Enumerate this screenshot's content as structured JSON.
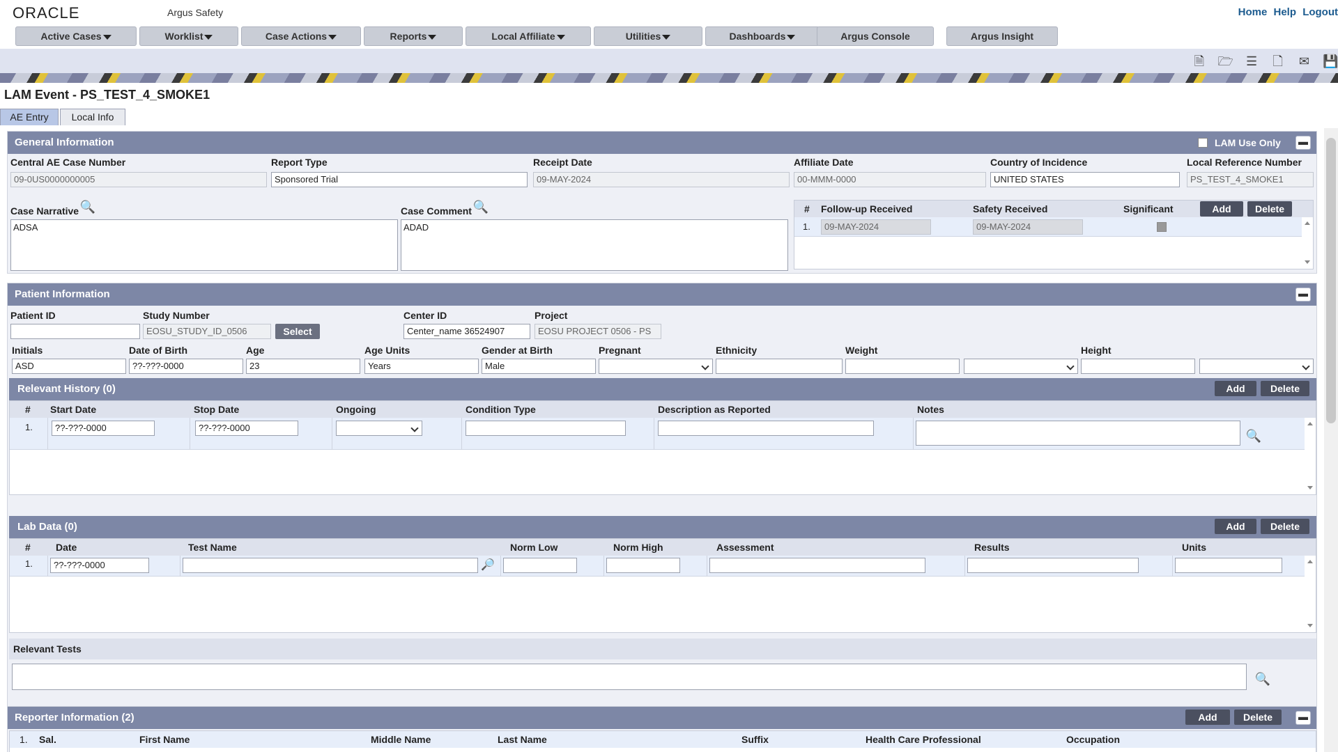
{
  "app": {
    "logo": "ORACLE",
    "product": "Argus Safety"
  },
  "toplinks": {
    "home": "Home",
    "help": "Help",
    "logout": "Logout"
  },
  "menus": [
    {
      "label": "Active Cases",
      "dropdown": true
    },
    {
      "label": "Worklist",
      "dropdown": true
    },
    {
      "label": "Case Actions",
      "dropdown": true
    },
    {
      "label": "Reports",
      "dropdown": true
    },
    {
      "label": "Local Affiliate",
      "dropdown": true
    },
    {
      "label": "Utilities",
      "dropdown": true
    },
    {
      "label": "Dashboards",
      "dropdown": true
    },
    {
      "label": "Argus Console",
      "dropdown": false
    },
    {
      "label": "Argus Insight",
      "dropdown": false
    }
  ],
  "toolbar_icons": [
    "new-case-icon",
    "open-case-icon",
    "case-list-icon",
    "new-document-icon",
    "inbox-icon",
    "save-icon"
  ],
  "page_title": "LAM Event - PS_TEST_4_SMOKE1",
  "tabs": [
    {
      "label": "AE Entry",
      "active": true
    },
    {
      "label": "Local Info",
      "active": false
    }
  ],
  "general": {
    "title": "General Information",
    "lam_use_only": "LAM Use Only",
    "central_case_label": "Central AE Case Number",
    "central_case_value": "09-0US0000000005",
    "report_type_label": "Report Type",
    "report_type_value": "Sponsored Trial",
    "receipt_date_label": "Receipt Date",
    "receipt_date_value": "09-MAY-2024",
    "affiliate_date_label": "Affiliate Date",
    "affiliate_date_value": "00-MMM-0000",
    "country_label": "Country of Incidence",
    "country_value": "UNITED STATES",
    "local_ref_label": "Local Reference Number",
    "local_ref_value": "PS_TEST_4_SMOKE1",
    "narrative_label": "Case Narrative",
    "narrative_value": "ADSA",
    "comment_label": "Case Comment",
    "comment_value": "ADAD",
    "followup": {
      "col_num": "#",
      "col_followup": "Follow-up Received",
      "col_safety": "Safety Received",
      "col_significant": "Significant",
      "add": "Add",
      "delete": "Delete",
      "rows": [
        {
          "num": "1.",
          "followup": "09-MAY-2024",
          "safety": "09-MAY-2024"
        }
      ]
    }
  },
  "patient": {
    "title": "Patient Information",
    "patient_id_label": "Patient ID",
    "patient_id_value": "",
    "study_label": "Study Number",
    "study_value": "EOSU_STUDY_ID_0506",
    "select_label": "Select",
    "center_label": "Center ID",
    "center_value": "Center_name 36524907",
    "project_label": "Project",
    "project_value": "EOSU PROJECT 0506 - PS",
    "initials_label": "Initials",
    "initials_value": "ASD",
    "dob_label": "Date of Birth",
    "dob_value": "??-???-0000",
    "age_label": "Age",
    "age_value": "23",
    "age_units_label": "Age Units",
    "age_units_value": "Years",
    "gender_label": "Gender at Birth",
    "gender_value": "Male",
    "pregnant_label": "Pregnant",
    "ethnicity_label": "Ethnicity",
    "weight_label": "Weight",
    "height_label": "Height"
  },
  "history": {
    "title": "Relevant History (0)",
    "add": "Add",
    "delete": "Delete",
    "cols": [
      "#",
      "Start Date",
      "Stop Date",
      "Ongoing",
      "Condition Type",
      "Description as Reported",
      "Notes"
    ],
    "row": {
      "num": "1.",
      "start": "??-???-0000",
      "stop": "??-???-0000"
    }
  },
  "lab": {
    "title": "Lab Data (0)",
    "add": "Add",
    "delete": "Delete",
    "cols": [
      "#",
      "Date",
      "Test Name",
      "Norm Low",
      "Norm High",
      "Assessment",
      "Results",
      "Units"
    ],
    "row": {
      "num": "1.",
      "date": "??-???-0000"
    }
  },
  "relevant_tests": {
    "label": "Relevant Tests"
  },
  "reporter": {
    "title": "Reporter Information (2)",
    "add": "Add",
    "delete": "Delete",
    "row_num": "1.",
    "cols": [
      "Sal.",
      "First Name",
      "Middle Name",
      "Last Name",
      "Suffix",
      "Health Care Professional",
      "Occupation"
    ]
  }
}
